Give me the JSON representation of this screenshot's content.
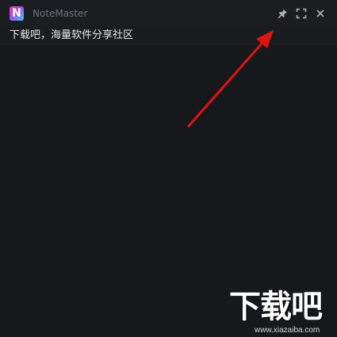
{
  "window": {
    "app_logo_letter": "N",
    "title": "NoteMaster",
    "icons": {
      "pin": "pin-icon",
      "fullscreen": "fullscreen-icon",
      "close": "close-icon"
    }
  },
  "note": {
    "text": "下载吧，海量软件分享社区"
  },
  "annotation": {
    "arrow_color": "#e01414"
  },
  "watermark": {
    "logo_text": "下载吧",
    "url": "www.xiazaiba.com"
  },
  "colors": {
    "background": "#16181c",
    "titlebar": "#1b1d21",
    "text": "#e4e6ea",
    "muted": "#6f737a"
  }
}
